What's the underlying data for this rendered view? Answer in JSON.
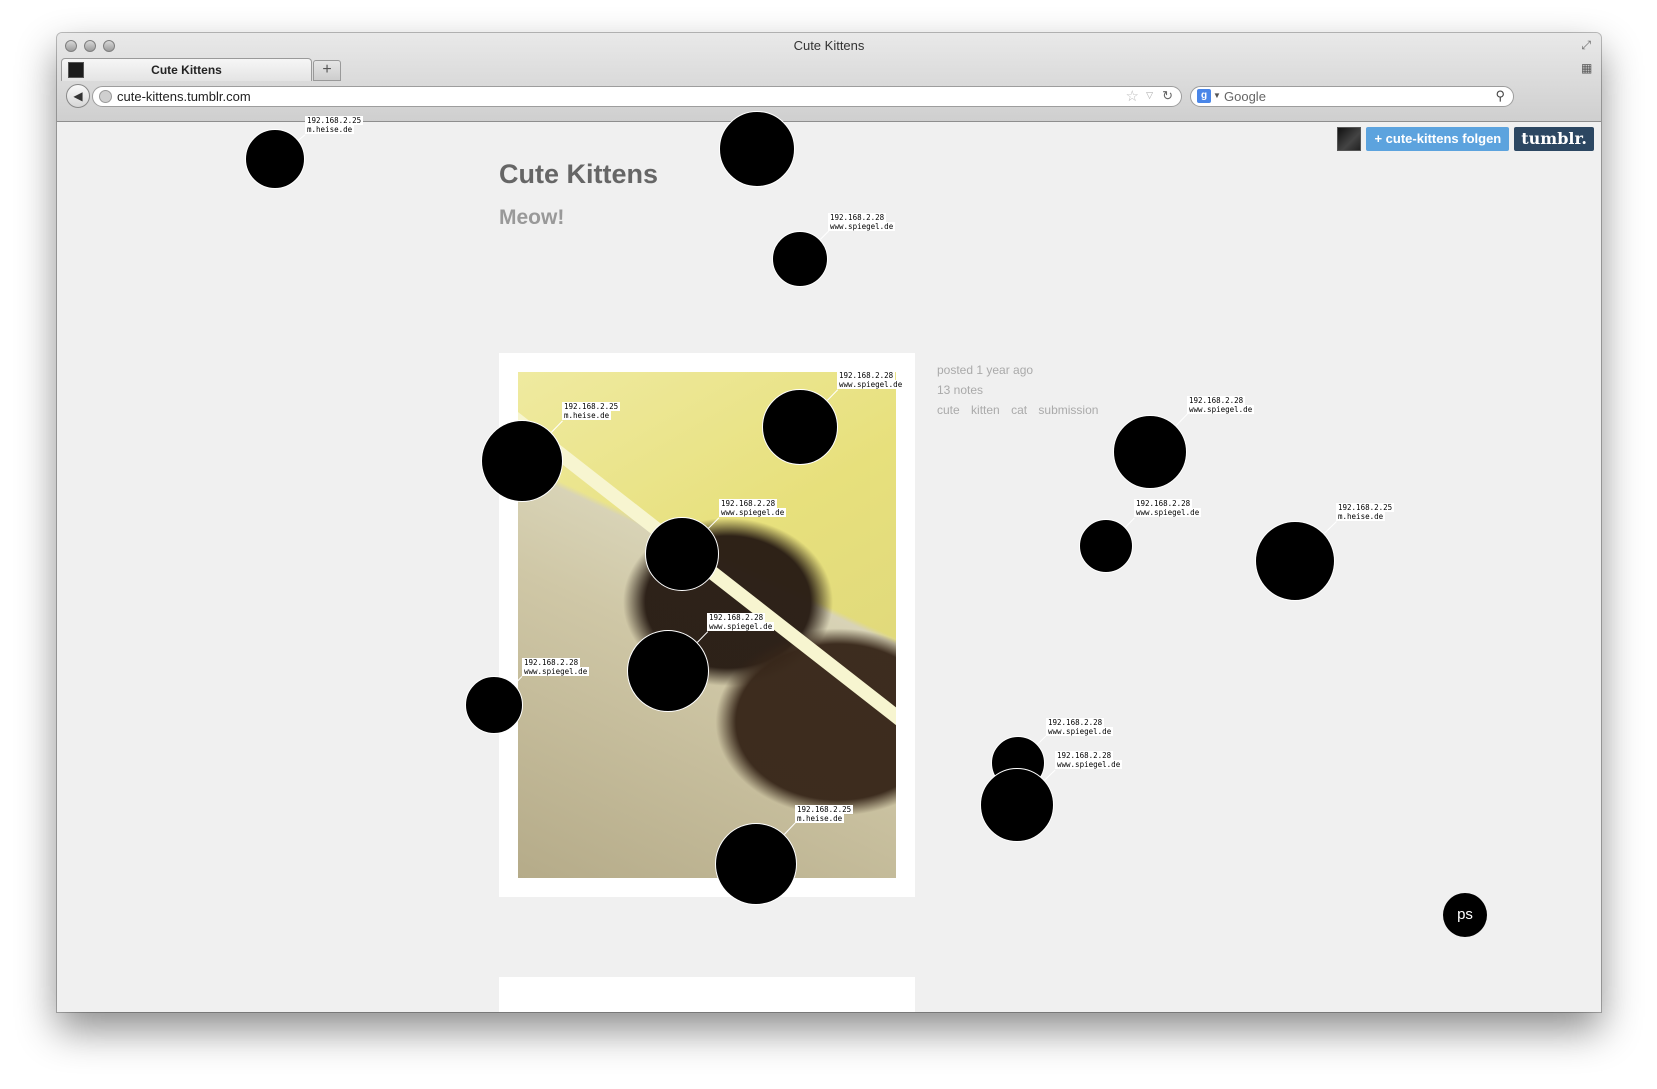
{
  "window": {
    "title": "Cute Kittens"
  },
  "tab": {
    "label": "Cute Kittens",
    "new_tab_label": "+"
  },
  "address_bar": {
    "url": "cute-kittens.tumblr.com"
  },
  "search_bar": {
    "engine": "g",
    "placeholder": "Google"
  },
  "tumblr_controls": {
    "follow_label": "+ cute-kittens folgen",
    "tumblr_label": "tumblr."
  },
  "blog": {
    "title": "Cute Kittens",
    "description": "Meow!"
  },
  "post": {
    "posted": "posted 1 year ago",
    "notes": "13 notes",
    "tags": [
      "cute",
      "kitten",
      "cat",
      "submission"
    ]
  },
  "overlay_button": {
    "label": "ps"
  },
  "tooltips": [
    {
      "ip": "192.168.2.25",
      "host": "m.heise.de"
    },
    {
      "ip": "192.168.2.28",
      "host": "www.spiegel.de"
    },
    {
      "ip": "192.168.2.28",
      "host": "www.spiegel.de"
    },
    {
      "ip": "192.168.2.25",
      "host": "m.heise.de"
    },
    {
      "ip": "192.168.2.28",
      "host": "www.spiegel.de"
    },
    {
      "ip": "192.168.2.28",
      "host": "www.spiegel.de"
    },
    {
      "ip": "192.168.2.28",
      "host": "www.spiegel.de"
    },
    {
      "ip": "192.168.2.25",
      "host": "m.heise.de"
    },
    {
      "ip": "192.168.2.28",
      "host": "www.spiegel.de"
    },
    {
      "ip": "192.168.2.28",
      "host": "www.spiegel.de"
    },
    {
      "ip": "192.168.2.25",
      "host": "m.heise.de"
    },
    {
      "ip": "192.168.2.28",
      "host": "www.spiegel.de"
    },
    {
      "ip": "192.168.2.28",
      "host": "www.spiegel.de"
    }
  ]
}
